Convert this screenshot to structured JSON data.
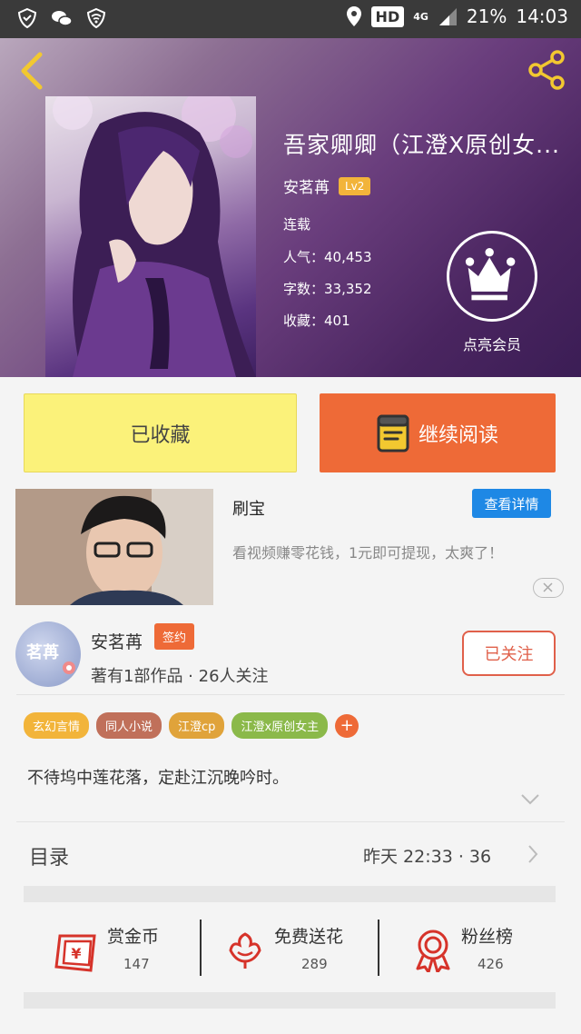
{
  "status_bar": {
    "hd": "HD",
    "network": "4G",
    "battery": "21%",
    "time": "14:03"
  },
  "book": {
    "title": "吾家卿卿（江澄X原创女...",
    "author": "安茗苒",
    "level": "Lv2",
    "status": "连载",
    "popularity": "人气：40,453",
    "word_count": "字数：33,352",
    "favorites": "收藏：401",
    "member_label": "点亮会员"
  },
  "actions": {
    "collected_label": "已收藏",
    "continue_label": "继续阅读"
  },
  "ad": {
    "title": "刷宝",
    "detail_label": "查看详情",
    "description": "看视频赚零花钱，1元即可提现，太爽了！"
  },
  "author_section": {
    "name": "安茗苒",
    "signed_label": "签约",
    "stats": "著有1部作品 · 26人关注",
    "follow_label": "已关注",
    "avatar_text": "茗苒"
  },
  "tags": [
    {
      "label": "玄幻言情",
      "color": "#f2b43a"
    },
    {
      "label": "同人小说",
      "color": "#c0705a"
    },
    {
      "label": "江澄cp",
      "color": "#e0a33a"
    },
    {
      "label": "江澄x原创女主",
      "color": "#8bb94a"
    }
  ],
  "tag_add": "+",
  "description": "不待坞中莲花落，定赴江沉晚吟时。",
  "toc": {
    "label": "目录",
    "updated": "昨天  22:33  ·  36"
  },
  "stats": [
    {
      "label": "赏金币",
      "value": "147",
      "icon": "red-envelope-icon"
    },
    {
      "label": "免费送花",
      "value": "289",
      "icon": "flower-icon"
    },
    {
      "label": "粉丝榜",
      "value": "426",
      "icon": "medal-icon"
    }
  ],
  "colors": {
    "accent": "#ee6a37",
    "collected_bg": "#fbf27a",
    "detail_blue": "#1e88e5",
    "icon_red": "#d6332a"
  }
}
